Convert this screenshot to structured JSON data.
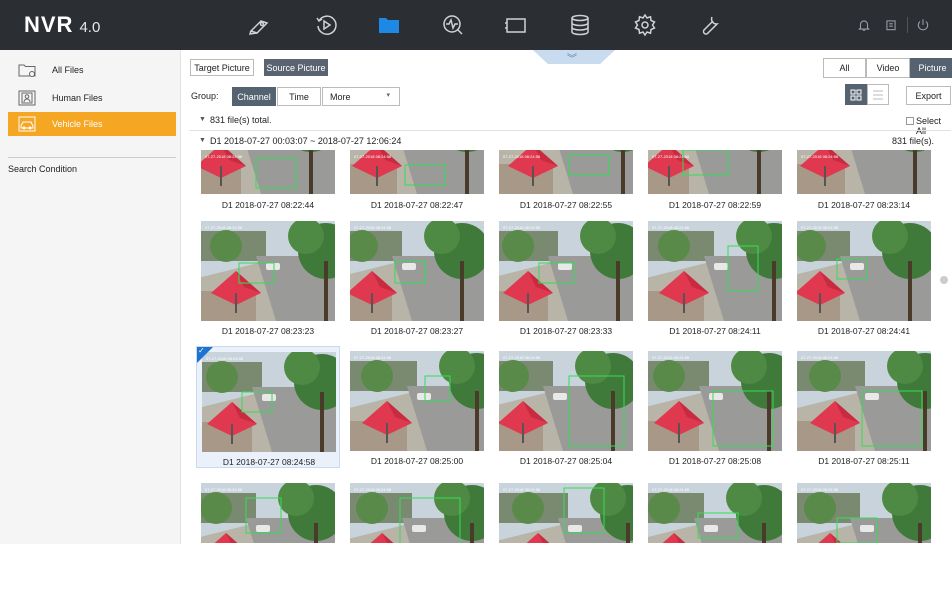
{
  "app": {
    "logo_main": "NVR",
    "logo_version": "4.0"
  },
  "topbar": {
    "icons": [
      "live-view-icon",
      "playback-icon",
      "file-management-icon",
      "smart-analysis-icon",
      "storage-camera-icon",
      "storage-icon",
      "system-settings-icon",
      "maintenance-icon",
      "notification-icon",
      "lock-icon",
      "power-icon"
    ],
    "active_index": 2,
    "active_color": "#1e88e5"
  },
  "sidebar": {
    "items": [
      {
        "label": "All Files",
        "icon": "folder-icon"
      },
      {
        "label": "Human Files",
        "icon": "human-icon"
      },
      {
        "label": "Vehicle Files",
        "icon": "vehicle-icon"
      }
    ],
    "active_index": 2,
    "search_condition": "Search Condition"
  },
  "toolbar": {
    "target_picture": "Target Picture",
    "source_picture": "Source Picture",
    "filter_all": "All",
    "filter_video": "Video",
    "filter_picture": "Picture",
    "group_label": "Group:",
    "group_channel": "Channel",
    "group_time": "Time",
    "group_more": "More",
    "export": "Export",
    "collapse": "︾"
  },
  "summary": {
    "total": "831 file(s) total.",
    "select_all": "Select All"
  },
  "group": {
    "title": "D1 2018-07-27 00:03:07 ~ 2018-07-27 12:06:24",
    "count": "831 file(s)."
  },
  "thumbnails": [
    {
      "caption": "D1 2018-07-27 08:22:44"
    },
    {
      "caption": "D1 2018-07-27 08:22:47"
    },
    {
      "caption": "D1 2018-07-27 08:22:55"
    },
    {
      "caption": "D1 2018-07-27 08:22:59"
    },
    {
      "caption": "D1 2018-07-27 08:23:14"
    },
    {
      "caption": "D1 2018-07-27 08:23:23"
    },
    {
      "caption": "D1 2018-07-27 08:23:27"
    },
    {
      "caption": "D1 2018-07-27 08:23:33"
    },
    {
      "caption": "D1 2018-07-27 08:24:11"
    },
    {
      "caption": "D1 2018-07-27 08:24:41"
    },
    {
      "caption": "D1 2018-07-27 08:24:58",
      "selected": true
    },
    {
      "caption": "D1 2018-07-27 08:25:00"
    },
    {
      "caption": "D1 2018-07-27 08:25:04"
    },
    {
      "caption": "D1 2018-07-27 08:25:08"
    },
    {
      "caption": "D1 2018-07-27 08:25:11"
    },
    {
      "caption": ""
    },
    {
      "caption": ""
    },
    {
      "caption": ""
    },
    {
      "caption": ""
    },
    {
      "caption": ""
    }
  ],
  "colors": {
    "accent_orange": "#f5a623",
    "topbar_bg": "#2b2e33",
    "detection_box": "#33dd55",
    "umbrella_red": "#e0384f"
  }
}
